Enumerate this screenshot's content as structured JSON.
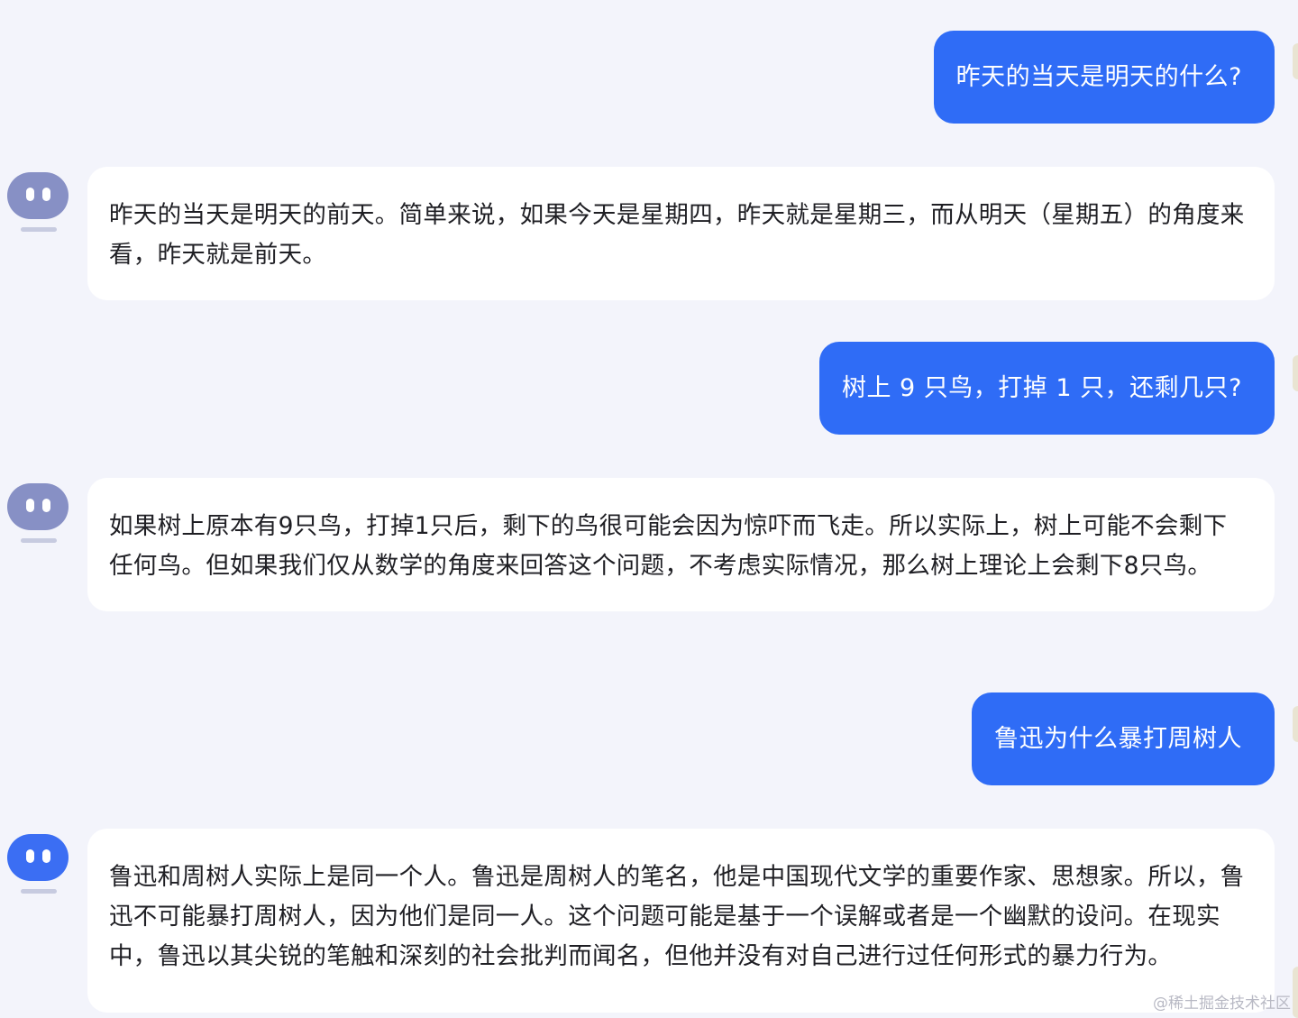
{
  "conversation": {
    "messages": [
      {
        "role": "user",
        "text": "昨天的当天是明天的什么?"
      },
      {
        "role": "assistant",
        "text": "昨天的当天是明天的前天。简单来说，如果今天是星期四，昨天就是星期三，而从明天（星期五）的角度来看，昨天就是前天。"
      },
      {
        "role": "user",
        "text": "树上 9 只鸟，打掉 1 只，还剩几只?"
      },
      {
        "role": "assistant",
        "text": "如果树上原本有9只鸟，打掉1只后，剩下的鸟很可能会因为惊吓而飞走。所以实际上，树上可能不会剩下任何鸟。但如果我们仅从数学的角度来回答这个问题，不考虑实际情况，那么树上理论上会剩下8只鸟。"
      },
      {
        "role": "user",
        "text": "鲁迅为什么暴打周树人"
      },
      {
        "role": "assistant",
        "text": "鲁迅和周树人实际上是同一个人。鲁迅是周树人的笔名，他是中国现代文学的重要作家、思想家。所以，鲁迅不可能暴打周树人，因为他们是同一人。这个问题可能是基于一个误解或者是一个幽默的设问。在现实中，鲁迅以其尖锐的笔触和深刻的社会批判而闻名，但他并没有对自己进行过任何形式的暴力行为。"
      }
    ]
  },
  "theme": {
    "user_bubble_color": "#2f6cf6",
    "bot_bubble_color": "#ffffff",
    "background_color": "#f3f4fb",
    "avatar_color": "#8790c5",
    "avatar_active_color": "#3b6ef3"
  },
  "icons": {
    "assistant_avatar": "robot-face-icon"
  },
  "watermark": "@稀土掘金技术社区"
}
